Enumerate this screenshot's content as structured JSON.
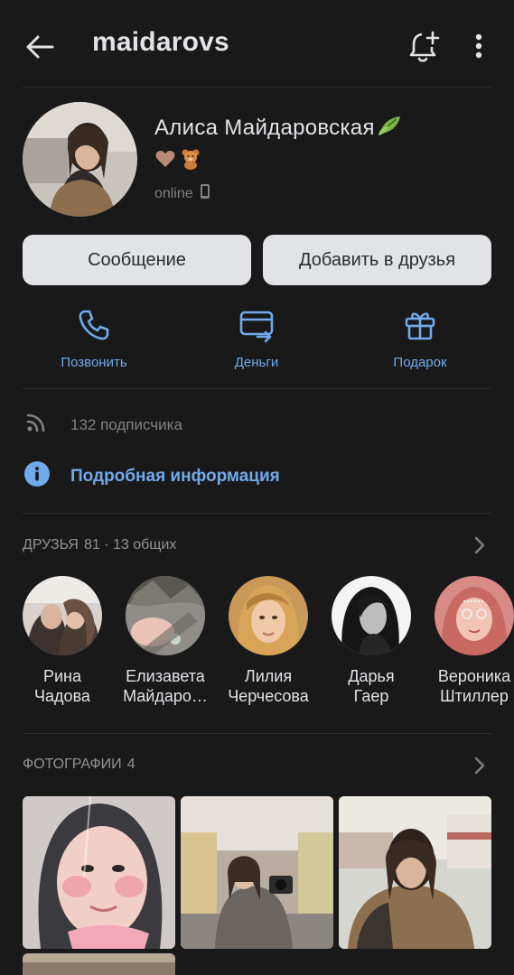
{
  "header": {
    "back_icon": "arrow-left-icon",
    "title": "maidarovs",
    "bell_icon": "bell-plus-icon",
    "more_icon": "more-vertical-icon"
  },
  "profile": {
    "name": "Алиса Майдаровская",
    "name_emoji_icon": "leaf-emoji-icon",
    "emojis": [
      "heart-emoji-icon",
      "teddy-bear-emoji-icon"
    ],
    "status": "online",
    "status_icon": "phone-icon"
  },
  "buttons": {
    "message": "Сообщение",
    "add_friend": "Добавить в друзья"
  },
  "actions": [
    {
      "label": "Позвонить",
      "icon": "phone-call-icon"
    },
    {
      "label": "Деньги",
      "icon": "money-transfer-icon"
    },
    {
      "label": "Подарок",
      "icon": "gift-icon"
    }
  ],
  "followers": {
    "icon": "rss-icon",
    "text": "132 подписчика"
  },
  "details": {
    "icon": "info-icon",
    "text": "Подробная информация"
  },
  "friends": {
    "title": "ДРУЗЬЯ",
    "count": "81 · 13 общих",
    "items": [
      {
        "name_line1": "Рина",
        "name_line2": "Чадова"
      },
      {
        "name_line1": "Елизавета",
        "name_line2": "Майдаро…"
      },
      {
        "name_line1": "Лилия",
        "name_line2": "Черчесова"
      },
      {
        "name_line1": "Дарья",
        "name_line2": "Гаер"
      },
      {
        "name_line1": "Вероника",
        "name_line2": "Штиллер"
      }
    ]
  },
  "photos": {
    "title": "ФОТОГРАФИИ",
    "count": "4"
  },
  "colors": {
    "background": "#19191a",
    "accent": "#71aaeb",
    "button_bg": "#e1e3e6",
    "text_primary": "#e1e3e6",
    "text_secondary": "#828282"
  }
}
